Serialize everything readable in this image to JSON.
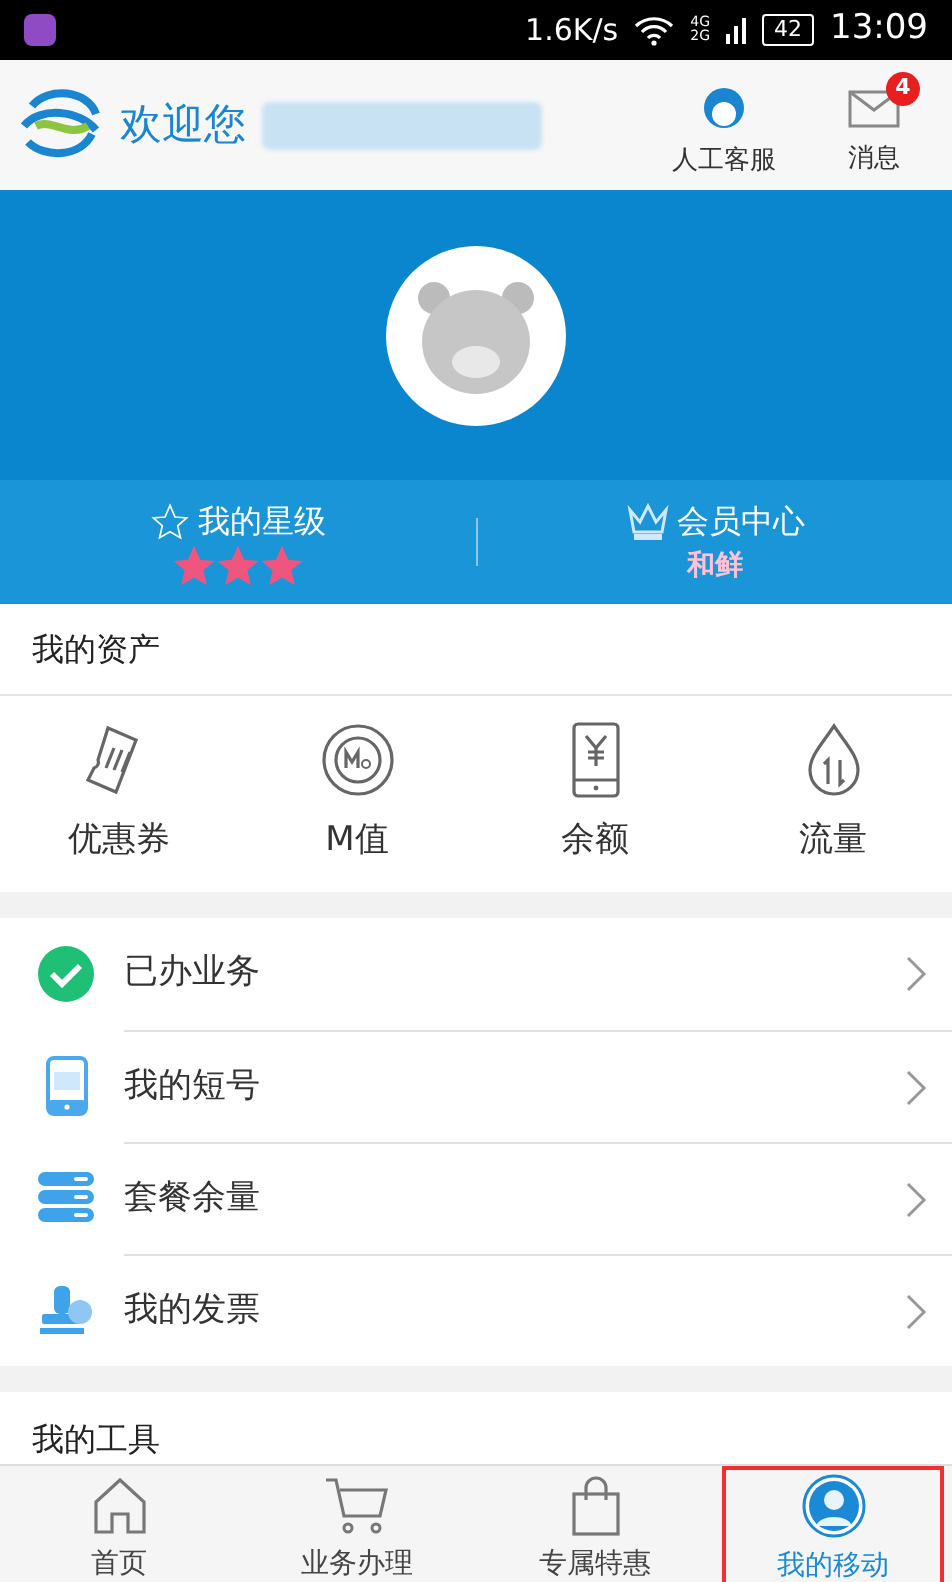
{
  "status_bar": {
    "speed": "1.6K/s",
    "network": [
      "4G",
      "2G"
    ],
    "battery": "42",
    "time": "13:09"
  },
  "header": {
    "greeting": "欢迎您",
    "actions": [
      {
        "label": "人工客服",
        "kind": "service"
      },
      {
        "label": "消息",
        "kind": "mail",
        "badge": "4"
      }
    ]
  },
  "profile": {
    "stats": [
      {
        "label": "我的星级",
        "kind": "stars",
        "stars": 3
      },
      {
        "label": "会员中心",
        "kind": "member",
        "value": "和鲜"
      }
    ]
  },
  "assets": {
    "title": "我的资产",
    "items": [
      {
        "label": "优惠券",
        "kind": "coupon"
      },
      {
        "label": "M值",
        "kind": "mvalue"
      },
      {
        "label": "余额",
        "kind": "balance"
      },
      {
        "label": "流量",
        "kind": "data"
      }
    ]
  },
  "menu": [
    {
      "label": "已办业务",
      "kind": "done"
    },
    {
      "label": "我的短号",
      "kind": "short"
    },
    {
      "label": "套餐余量",
      "kind": "plan"
    },
    {
      "label": "我的发票",
      "kind": "invoice"
    }
  ],
  "tools": {
    "title": "我的工具"
  },
  "nav": [
    {
      "label": "首页",
      "kind": "home",
      "selected": false
    },
    {
      "label": "业务办理",
      "kind": "cart",
      "selected": false
    },
    {
      "label": "专属特惠",
      "kind": "bag",
      "selected": false
    },
    {
      "label": "我的移动",
      "kind": "user",
      "selected": true
    }
  ]
}
